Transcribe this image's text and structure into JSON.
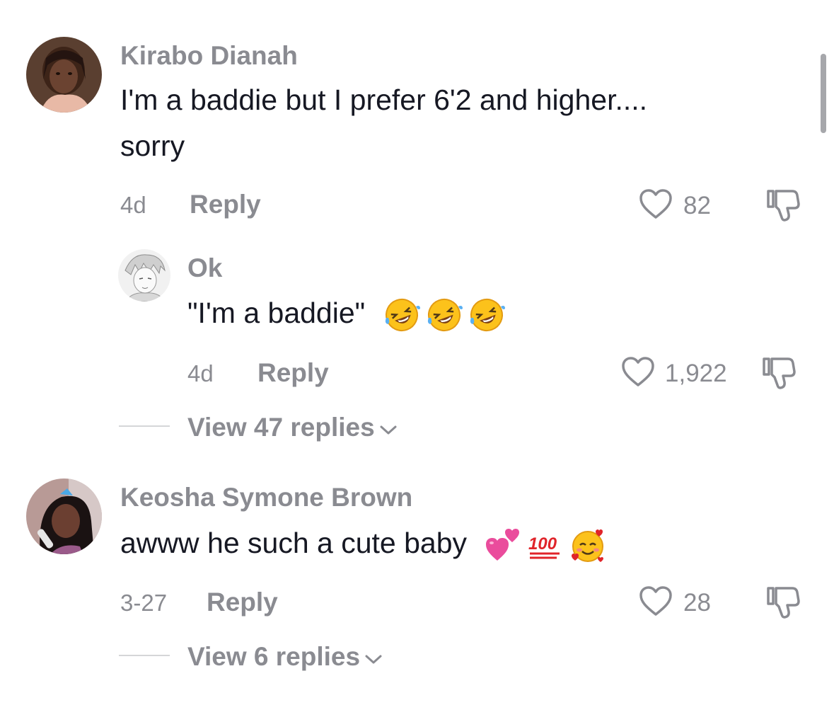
{
  "comments": [
    {
      "username": "Kirabo Dianah",
      "text_line1": "I'm a baddie but I prefer 6'2 and higher....",
      "text_line2": "sorry",
      "time": "4d",
      "reply_label": "Reply",
      "likes": "82",
      "reply": {
        "username": "Ok",
        "text": "\"I'm a baddie\"",
        "emojis": [
          "rofl-emoji",
          "rofl-emoji",
          "rofl-emoji"
        ],
        "time": "4d",
        "reply_label": "Reply",
        "likes": "1,922"
      },
      "view_replies": "View 47 replies"
    },
    {
      "username": "Keosha Symone Brown",
      "text": "awww he such a cute baby",
      "emojis": [
        "two-hearts-emoji",
        "hundred-points-emoji",
        "smiling-face-with-hearts-emoji"
      ],
      "time": "3-27",
      "reply_label": "Reply",
      "likes": "28",
      "view_replies": "View 6 replies"
    }
  ],
  "icons": {
    "like": "heart-outline-icon",
    "dislike": "thumbs-down-icon",
    "expand": "chevron-down-icon"
  },
  "colors": {
    "primary_text": "#161823",
    "secondary_text": "#8a8b91",
    "divider": "#d5d6d8",
    "icon_stroke": "#8a8b91"
  }
}
